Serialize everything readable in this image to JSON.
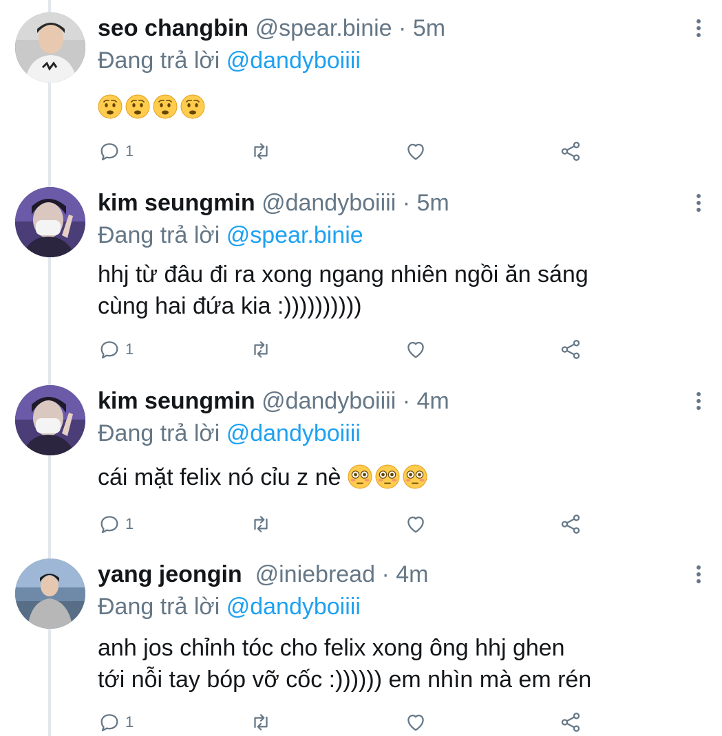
{
  "tweets": [
    {
      "name": "seo changbin",
      "handle": "@spear.binie",
      "time": "5m",
      "replying_prefix": "Đang trả lời ",
      "mention": "@dandyboiiii",
      "text": "",
      "emojis": [
        "anxious-face",
        "anxious-face",
        "anxious-face",
        "anxious-face"
      ],
      "reply_count": "1"
    },
    {
      "name": "kim seungmin",
      "handle": "@dandyboiiii",
      "time": "5m",
      "replying_prefix": "Đang trả lời ",
      "mention": "@spear.binie",
      "text_line1": "hhj từ đâu đi ra xong ngang nhiên ngồi ăn sáng",
      "text_line2": "cùng hai đứa kia :))))))))))",
      "reply_count": "1"
    },
    {
      "name": "kim seungmin",
      "handle": "@dandyboiiii",
      "time": "4m",
      "replying_prefix": "Đang trả lời ",
      "mention": "@dandyboiiii",
      "text_line1": "cái mặt felix nó cỉu z nè",
      "emojis": [
        "flushed-face",
        "flushed-face",
        "flushed-face"
      ],
      "reply_count": "1"
    },
    {
      "name": "yang jeongin",
      "handle": "@iniebread",
      "time": "4m",
      "replying_prefix": "Đang trả lời ",
      "mention": "@dandyboiiii",
      "text_line1": "anh jos chỉnh tóc cho felix xong ông hhj ghen",
      "text_line2": "tới nỗi tay bóp vỡ cốc :)))))) em nhìn mà em rén",
      "reply_count": "1"
    }
  ],
  "separator": "·",
  "icons": [
    "reply-icon",
    "retweet-icon",
    "like-icon",
    "share-icon",
    "more-icon"
  ],
  "colors": {
    "mention": "#1da1f2",
    "secondary": "#657786",
    "thread_line": "#e1e8ed"
  }
}
